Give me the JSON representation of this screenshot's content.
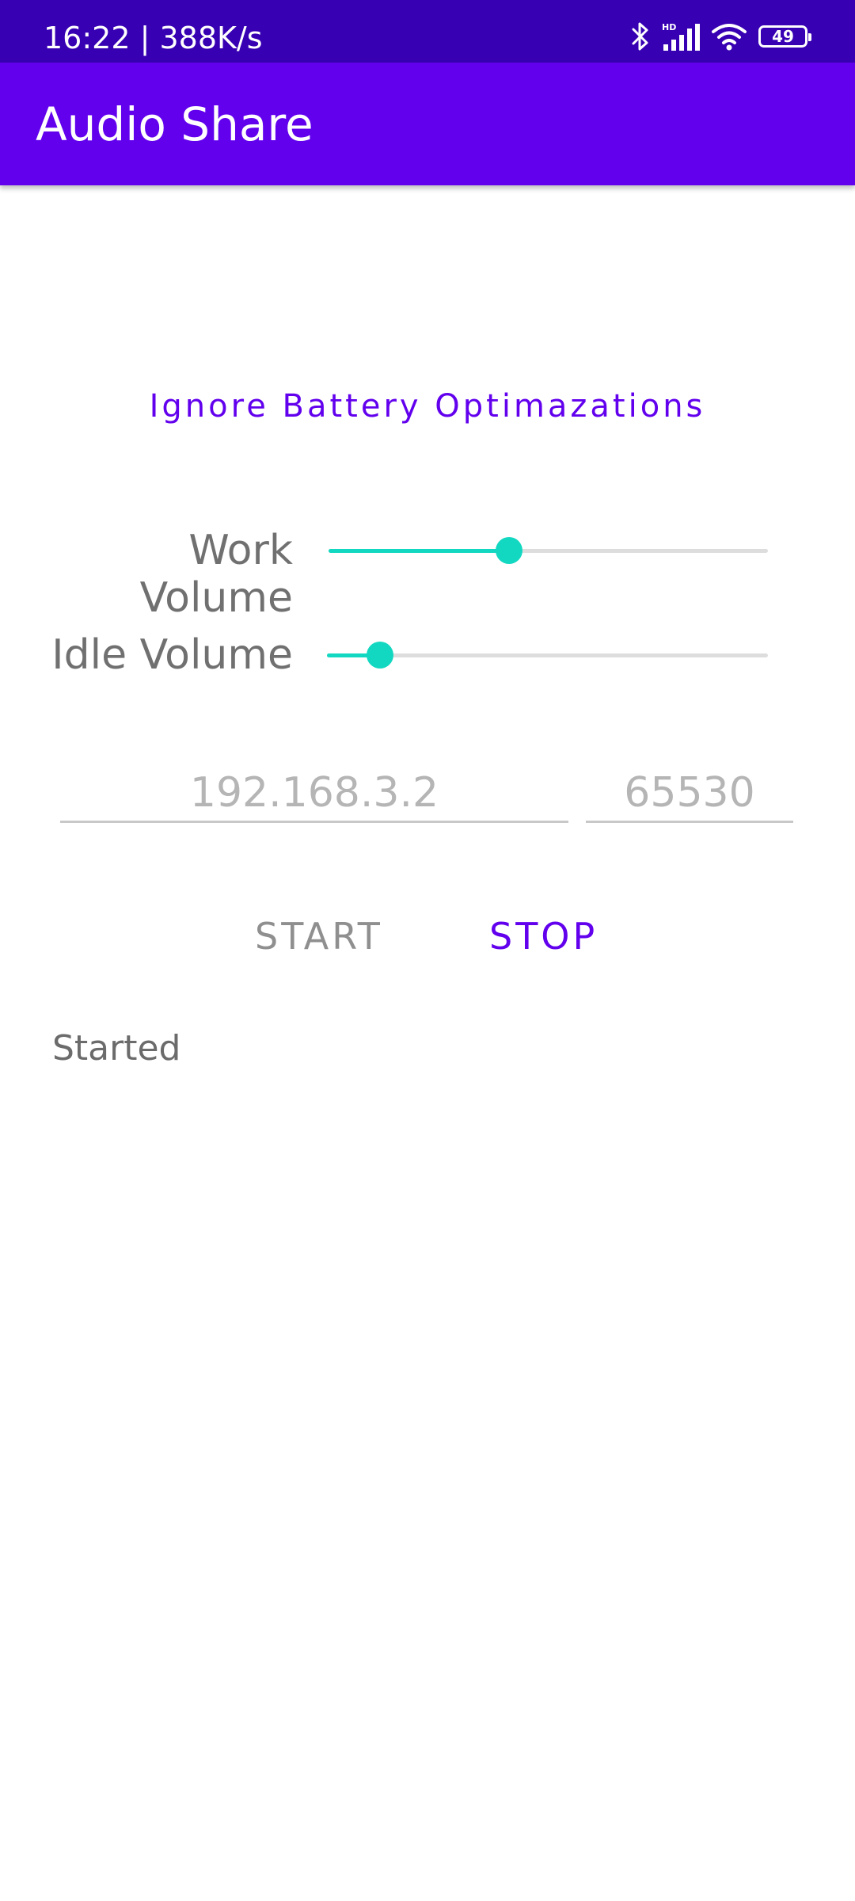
{
  "status_bar": {
    "time_speed": "16:22 | 388K/s",
    "battery_level": "49",
    "icons": [
      "bluetooth-icon",
      "signal-hd-icon",
      "wifi-icon",
      "battery-icon"
    ]
  },
  "app_bar": {
    "title": "Audio Share"
  },
  "battery_link": {
    "label": "Ignore Battery Optimazations"
  },
  "work_volume": {
    "label": "Work Volume",
    "level": 0.41
  },
  "idle_volume": {
    "label": "Idle Volume",
    "level": 0.12
  },
  "inputs": {
    "ip_placeholder": "192.168.3.2",
    "port_placeholder": "65530"
  },
  "buttons": {
    "start": "START",
    "stop": "STOP"
  },
  "status_message": "Started",
  "colors": {
    "status_bar": "#3700b3",
    "app_bar": "#6200ee",
    "accent": "#13d8c1",
    "primary_text_button": "#6200ee"
  }
}
